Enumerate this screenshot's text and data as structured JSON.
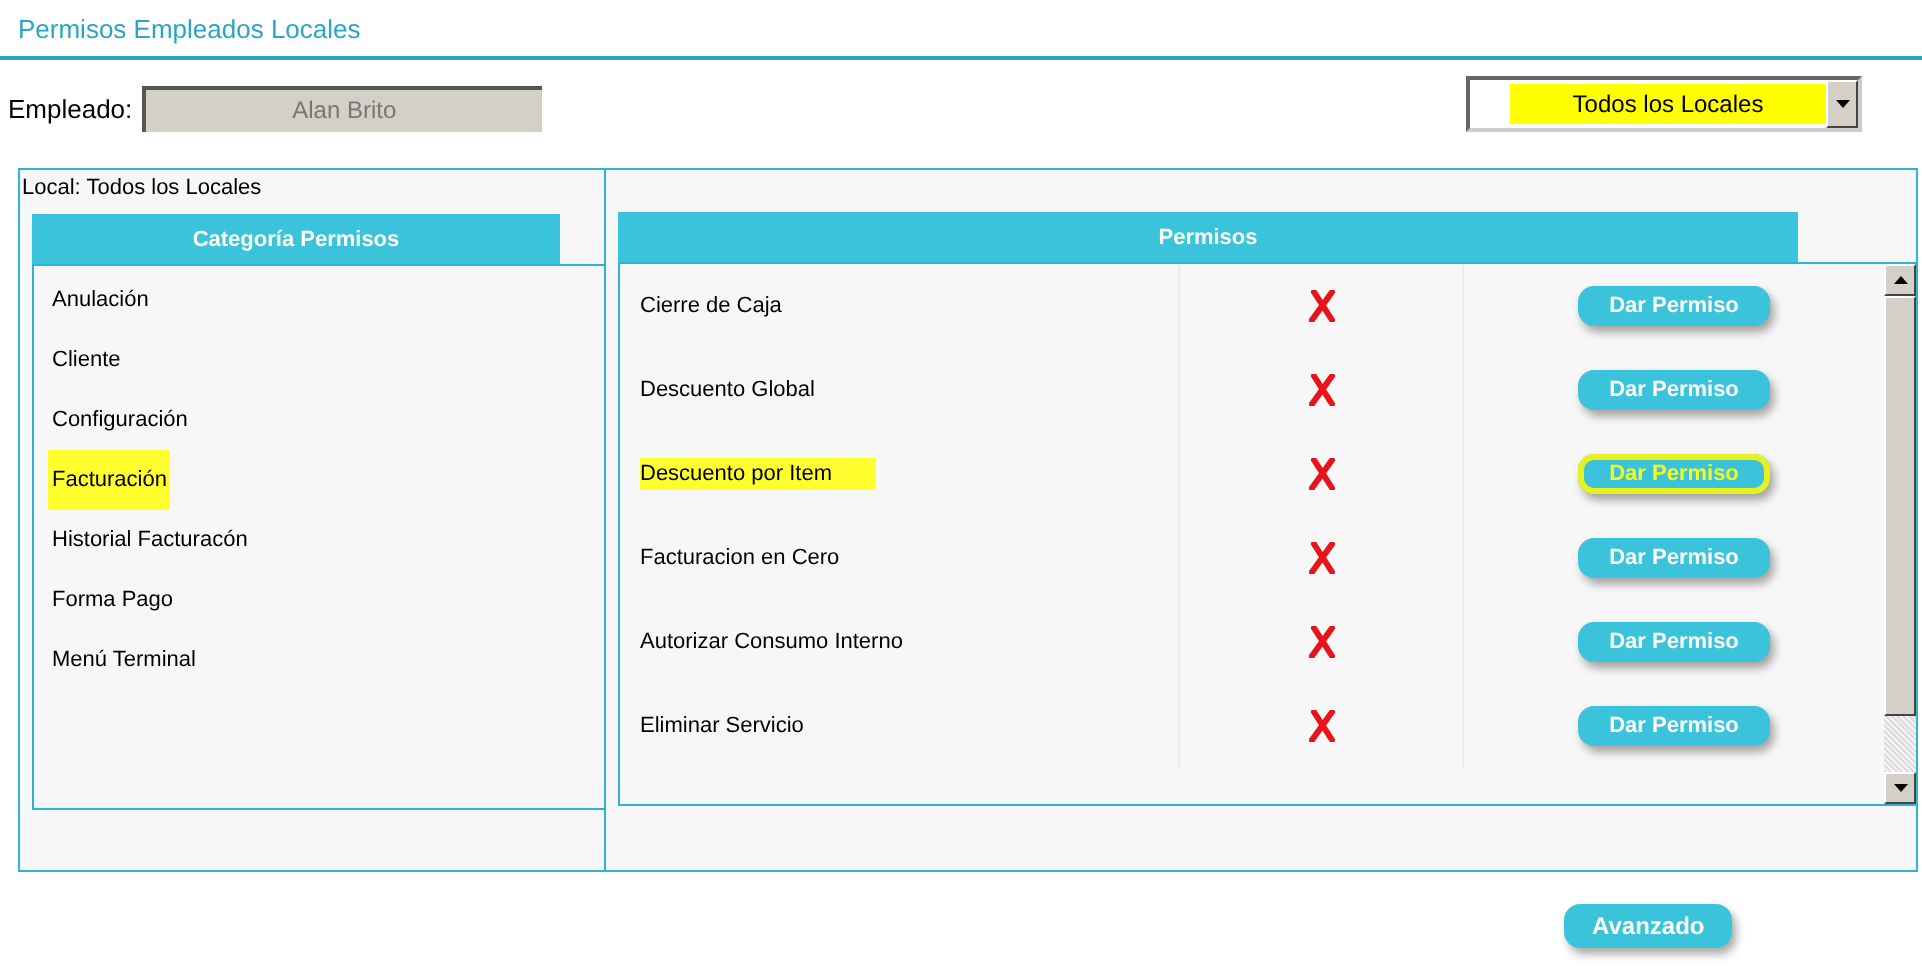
{
  "page_title": "Permisos Empleados Locales",
  "employee": {
    "label": "Empleado:",
    "value": "Alan Brito"
  },
  "local_select": {
    "value": "Todos los Locales",
    "highlighted": true
  },
  "local_label": "Local: Todos los Locales",
  "categories": {
    "header": "Categoría Permisos",
    "items": [
      {
        "label": "Anulación",
        "highlighted": false
      },
      {
        "label": "Cliente",
        "highlighted": false
      },
      {
        "label": "Configuración",
        "highlighted": false
      },
      {
        "label": "Facturación",
        "highlighted": true
      },
      {
        "label": "Historial Facturacón",
        "highlighted": false
      },
      {
        "label": "Forma Pago",
        "highlighted": false
      },
      {
        "label": "Menú Terminal",
        "highlighted": false
      }
    ]
  },
  "permissions": {
    "header": "Permisos",
    "rows": [
      {
        "name": "Cierre de Caja",
        "granted": false,
        "button": "Dar Permiso",
        "highlighted": false
      },
      {
        "name": "Descuento Global",
        "granted": false,
        "button": "Dar Permiso",
        "highlighted": false
      },
      {
        "name": "Descuento por Item",
        "granted": false,
        "button": "Dar Permiso",
        "highlighted": true
      },
      {
        "name": "Facturacion en Cero",
        "granted": false,
        "button": "Dar Permiso",
        "highlighted": false
      },
      {
        "name": "Autorizar Consumo Interno",
        "granted": false,
        "button": "Dar Permiso",
        "highlighted": false
      },
      {
        "name": "Eliminar Servicio",
        "granted": false,
        "button": "Dar Permiso",
        "highlighted": false
      }
    ]
  },
  "advanced_button": "Avanzado"
}
